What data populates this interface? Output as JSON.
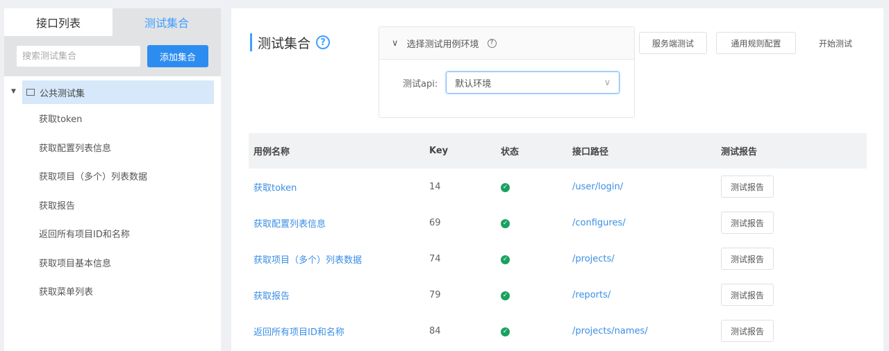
{
  "left": {
    "tabs": [
      "接口列表",
      "测试集合"
    ],
    "search_placeholder": "搜索测试集合",
    "add_button": "添加集合",
    "tree": {
      "root": "公共测试集",
      "items": [
        "获取token",
        "获取配置列表信息",
        "获取项目（多个）列表数据",
        "获取报告",
        "返回所有项目ID和名称",
        "获取项目基本信息",
        "获取菜单列表"
      ]
    }
  },
  "main": {
    "title": "测试集合",
    "env": {
      "header": "选择测试用例环境",
      "label": "测试api:",
      "value": "默认环境"
    },
    "buttons": {
      "server": "服务端测试",
      "rules": "通用规则配置",
      "start": "开始测试"
    },
    "table": {
      "headers": [
        "用例名称",
        "Key",
        "状态",
        "接口路径",
        "测试报告"
      ],
      "rows": [
        {
          "name": "获取token",
          "key": "14",
          "path": "/user/login/",
          "report": "测试报告"
        },
        {
          "name": "获取配置列表信息",
          "key": "69",
          "path": "/configures/",
          "report": "测试报告"
        },
        {
          "name": "获取项目（多个）列表数据",
          "key": "74",
          "path": "/projects/",
          "report": "测试报告"
        },
        {
          "name": "获取报告",
          "key": "79",
          "path": "/reports/",
          "report": "测试报告"
        },
        {
          "name": "返回所有项目ID和名称",
          "key": "84",
          "path": "/projects/names/",
          "report": "测试报告"
        }
      ]
    }
  }
}
